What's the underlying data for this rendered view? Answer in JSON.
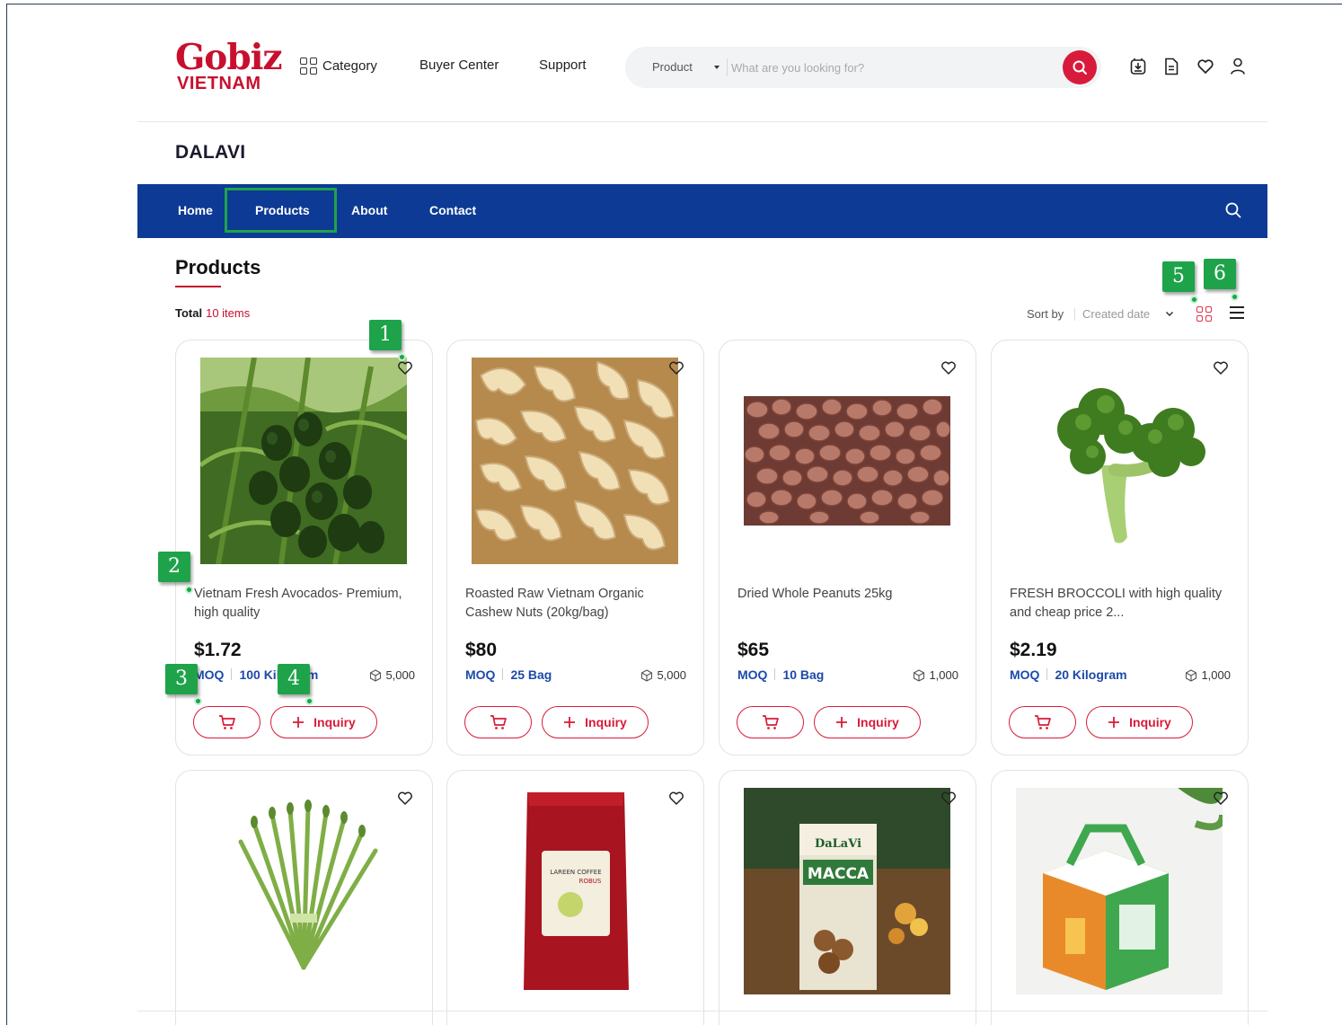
{
  "header": {
    "logo_main": "Gobiz",
    "logo_sub": "VIETNAM",
    "nav": [
      {
        "label": "Category"
      },
      {
        "label": "Buyer Center"
      },
      {
        "label": "Support"
      }
    ],
    "search": {
      "category": "Product",
      "placeholder": "What are you looking for?"
    },
    "icons": [
      "download-box-icon",
      "document-icon",
      "heart-icon",
      "user-icon"
    ]
  },
  "store": {
    "name": "DALAVI",
    "nav": [
      {
        "label": "Home"
      },
      {
        "label": "Products"
      },
      {
        "label": "About"
      },
      {
        "label": "Contact"
      }
    ],
    "active_nav": "Products"
  },
  "products_section": {
    "title": "Products",
    "total_label": "Total",
    "total_count": "10 items",
    "sort_label": "Sort by",
    "sort_value": "Created date"
  },
  "products": [
    {
      "name": "Vietnam Fresh Avocados- Premium, high quality",
      "price": "$1.72",
      "moq_label": "MOQ",
      "moq_value": "100 Kilogram",
      "stock": "5,000",
      "inquiry_label": "Inquiry"
    },
    {
      "name": "Roasted Raw Vietnam Organic Cashew Nuts (20kg/bag)",
      "price": "$80",
      "moq_label": "MOQ",
      "moq_value": "25 Bag",
      "stock": "5,000",
      "inquiry_label": "Inquiry"
    },
    {
      "name": "Dried Whole Peanuts 25kg",
      "price": "$65",
      "moq_label": "MOQ",
      "moq_value": "10 Bag",
      "stock": "1,000",
      "inquiry_label": "Inquiry"
    },
    {
      "name": "FRESH BROCCOLI with high quality and cheap price 2...",
      "price": "$2.19",
      "moq_label": "MOQ",
      "moq_value": "20 Kilogram",
      "stock": "1,000",
      "inquiry_label": "Inquiry"
    }
  ],
  "row2_products": [
    {
      "image": "asparagus"
    },
    {
      "image": "coffee-bag",
      "label_text": "LAREEN COFFEE",
      "label_sub": "ROBUS"
    },
    {
      "image": "macadamia-box",
      "brand": "DaLaVi",
      "label_text": "MACCA"
    },
    {
      "image": "gift-box"
    }
  ],
  "markers": [
    "1",
    "2",
    "3",
    "4",
    "5",
    "6"
  ],
  "colors": {
    "brand_red": "#c8102e",
    "nav_blue": "#0d3a94",
    "moq_blue": "#1d4aa8",
    "highlight_green": "#1fa34a"
  }
}
